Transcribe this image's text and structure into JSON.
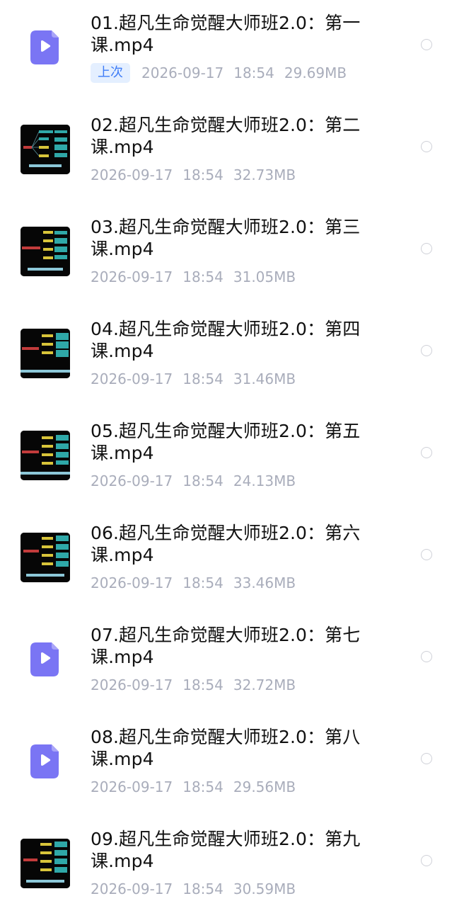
{
  "files": [
    {
      "name": "01.超凡生命觉醒大师班2.0：第一课.mp4",
      "badge": "上次",
      "date": "2026-09-17",
      "time": "18:54",
      "size": "29.69MB",
      "icon": "video-file-icon"
    },
    {
      "name": "02.超凡生命觉醒大师班2.0：第二课.mp4",
      "badge": "",
      "date": "2026-09-17",
      "time": "18:54",
      "size": "32.73MB",
      "icon": "video-thumbnail"
    },
    {
      "name": "03.超凡生命觉醒大师班2.0：第三课.mp4",
      "badge": "",
      "date": "2026-09-17",
      "time": "18:54",
      "size": "31.05MB",
      "icon": "video-thumbnail"
    },
    {
      "name": "04.超凡生命觉醒大师班2.0：第四课.mp4",
      "badge": "",
      "date": "2026-09-17",
      "time": "18:54",
      "size": "31.46MB",
      "icon": "video-thumbnail"
    },
    {
      "name": "05.超凡生命觉醒大师班2.0：第五课.mp4",
      "badge": "",
      "date": "2026-09-17",
      "time": "18:54",
      "size": "24.13MB",
      "icon": "video-thumbnail"
    },
    {
      "name": "06.超凡生命觉醒大师班2.0：第六课.mp4",
      "badge": "",
      "date": "2026-09-17",
      "time": "18:54",
      "size": "33.46MB",
      "icon": "video-thumbnail"
    },
    {
      "name": "07.超凡生命觉醒大师班2.0：第七课.mp4",
      "badge": "",
      "date": "2026-09-17",
      "time": "18:54",
      "size": "32.72MB",
      "icon": "video-file-icon"
    },
    {
      "name": "08.超凡生命觉醒大师班2.0：第八课.mp4",
      "badge": "",
      "date": "2026-09-17",
      "time": "18:54",
      "size": "29.56MB",
      "icon": "video-file-icon"
    },
    {
      "name": "09.超凡生命觉醒大师班2.0：第九课.mp4",
      "badge": "",
      "date": "2026-09-17",
      "time": "18:54",
      "size": "30.59MB",
      "icon": "video-thumbnail"
    }
  ],
  "colors": {
    "icon_purple": "#7a75f4",
    "badge_bg": "#e4efff",
    "badge_text": "#3e7cf7",
    "meta_gray": "#a9adbb"
  }
}
